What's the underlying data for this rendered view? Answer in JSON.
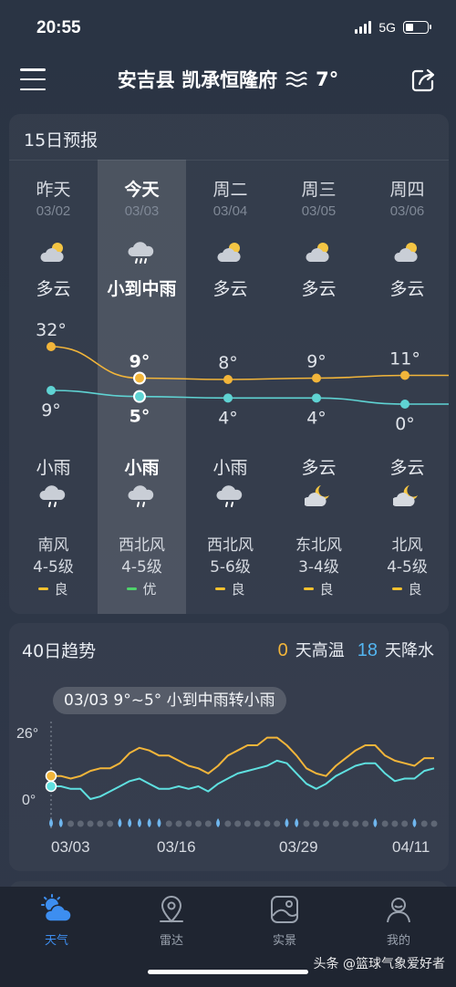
{
  "status_bar": {
    "time": "20:55",
    "network": "5G"
  },
  "header": {
    "location": "安吉县 凯承恒隆府",
    "temperature": "7°",
    "weather_icon": "haze-icon"
  },
  "forecast": {
    "title": "15日预报",
    "days": [
      {
        "name": "昨天",
        "date": "03/02",
        "day_condition": "多云",
        "day_icon": "partly-cloudy-icon",
        "high": "32°",
        "low": "9°",
        "night_condition": "小雨",
        "night_icon": "light-rain-icon",
        "wind_direction": "南风",
        "wind_level": "4-5级",
        "aqi": "良",
        "aqi_color": "#f2c12e",
        "high_value": 32,
        "low_value": 9
      },
      {
        "name": "今天",
        "date": "03/03",
        "day_condition": "小到中雨",
        "day_icon": "rain-icon",
        "high": "9°",
        "low": "5°",
        "night_condition": "小雨",
        "night_icon": "light-rain-icon",
        "wind_direction": "西北风",
        "wind_level": "4-5级",
        "aqi": "优",
        "aqi_color": "#4fd36b",
        "high_value": 9,
        "low_value": 5
      },
      {
        "name": "周二",
        "date": "03/04",
        "day_condition": "多云",
        "day_icon": "partly-cloudy-icon",
        "high": "8°",
        "low": "4°",
        "night_condition": "小雨",
        "night_icon": "light-rain-icon",
        "wind_direction": "西北风",
        "wind_level": "5-6级",
        "aqi": "良",
        "aqi_color": "#f2c12e",
        "high_value": 8,
        "low_value": 4
      },
      {
        "name": "周三",
        "date": "03/05",
        "day_condition": "多云",
        "day_icon": "partly-cloudy-icon",
        "high": "9°",
        "low": "4°",
        "night_condition": "多云",
        "night_icon": "cloudy-night-icon",
        "wind_direction": "东北风",
        "wind_level": "3-4级",
        "aqi": "良",
        "aqi_color": "#f2c12e",
        "high_value": 9,
        "low_value": 4
      },
      {
        "name": "周四",
        "date": "03/06",
        "day_condition": "多云",
        "day_icon": "partly-cloudy-icon",
        "high": "11°",
        "low": "0°",
        "night_condition": "多云",
        "night_icon": "cloudy-night-icon",
        "wind_direction": "北风",
        "wind_level": "4-5级",
        "aqi": "良",
        "aqi_color": "#f2c12e",
        "high_value": 11,
        "low_value": 0
      }
    ]
  },
  "trend": {
    "title": "40日趋势",
    "hot_days": "0",
    "hot_label": "天高温",
    "rain_days": "18",
    "rain_label": "天降水",
    "tooltip": "03/03 9°~5° 小到中雨转小雨",
    "y_top_label": "26°",
    "y_bottom_label": "0°",
    "dates": [
      "03/03",
      "03/16",
      "03/29",
      "04/11"
    ],
    "colors": {
      "high": "#f2b53a",
      "low": "#5fe0e0"
    },
    "high_series": [
      9,
      9,
      8,
      9,
      11,
      12,
      12,
      14,
      18,
      20,
      19,
      17,
      17,
      15,
      13,
      12,
      10,
      13,
      17,
      19,
      21,
      21,
      24,
      24,
      21,
      17,
      12,
      10,
      9,
      13,
      16,
      19,
      21,
      21,
      17,
      15,
      14,
      13,
      16,
      16
    ],
    "low_series": [
      5,
      5,
      4,
      4,
      0,
      1,
      3,
      5,
      7,
      8,
      6,
      4,
      4,
      5,
      4,
      5,
      3,
      6,
      8,
      10,
      11,
      12,
      13,
      15,
      14,
      10,
      6,
      4,
      6,
      9,
      11,
      13,
      14,
      14,
      10,
      7,
      8,
      8,
      11,
      12
    ],
    "rain_days_pattern": [
      1,
      1,
      0,
      0,
      0,
      0,
      0,
      1,
      1,
      1,
      1,
      1,
      0,
      0,
      0,
      0,
      0,
      1,
      0,
      0,
      0,
      0,
      0,
      0,
      1,
      1,
      0,
      0,
      0,
      0,
      0,
      0,
      0,
      1,
      0,
      0,
      0,
      1,
      0,
      0
    ]
  },
  "tabs": [
    {
      "label": "天气",
      "icon": "weather-tab-icon",
      "active": true
    },
    {
      "label": "雷达",
      "icon": "radar-location-icon",
      "active": false
    },
    {
      "label": "实景",
      "icon": "live-scene-icon",
      "active": false
    },
    {
      "label": "我的",
      "icon": "profile-icon",
      "active": false
    }
  ],
  "watermark": "头条 @篮球气象爱好者"
}
